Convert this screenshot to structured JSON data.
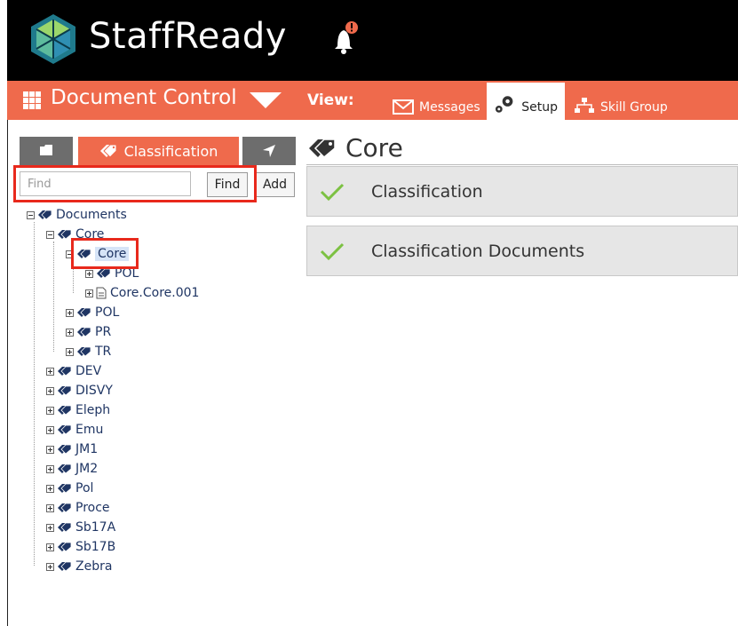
{
  "header": {
    "brand": "StaffReady",
    "logo_icon": "hexagon-cube-logo",
    "notification_icon": "bell-alert-icon"
  },
  "nav": {
    "module_title": "Document Control",
    "view_label": "View:",
    "tabs": [
      {
        "label": "Messages",
        "icon": "envelope-icon",
        "active": false
      },
      {
        "label": "Setup",
        "icon": "gears-icon",
        "active": true
      },
      {
        "label": "Skill Group",
        "icon": "sitemap-icon",
        "active": false
      }
    ]
  },
  "left_panel": {
    "tabs": [
      {
        "label": "",
        "icon": "folder-icon"
      },
      {
        "label": "Classification",
        "icon": "tags-icon",
        "active": true
      },
      {
        "label": "",
        "icon": "location-arrow-icon"
      }
    ],
    "search": {
      "placeholder": "Find",
      "value": ""
    },
    "find_button": "Find",
    "add_button": "Add"
  },
  "tree": {
    "root": "Documents",
    "core_parent": "Core",
    "core_selected": "Core",
    "core_children": [
      "POL",
      "Core.Core.001"
    ],
    "core_siblings": [
      "POL",
      "PR",
      "TR"
    ],
    "top_items": [
      "DEV",
      "DISVY",
      "Eleph",
      "Emu",
      "JM1",
      "JM2",
      "Pol",
      "Proce",
      "Sb17A",
      "Sb17B",
      "Zebra"
    ]
  },
  "content": {
    "title": "Core",
    "sections": [
      {
        "label": "Classification",
        "status": "check"
      },
      {
        "label": "Classification Documents",
        "status": "check"
      }
    ]
  },
  "colors": {
    "accent": "#ef6a4c",
    "header_bg": "#000000",
    "highlight": "#e8291c",
    "check": "#7cc142"
  }
}
